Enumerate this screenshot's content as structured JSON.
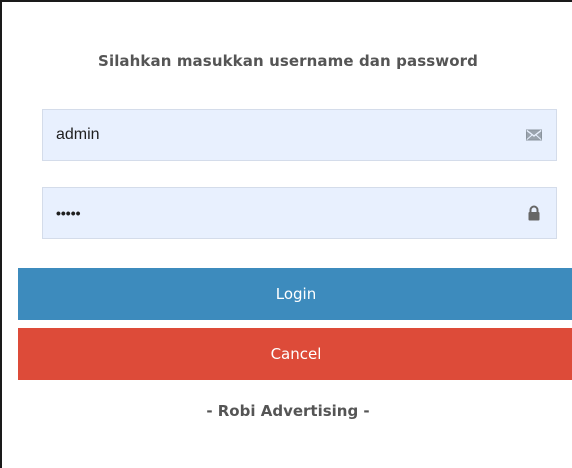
{
  "form": {
    "title": "Silahkan masukkan username dan password",
    "username": {
      "value": "admin",
      "icon": "envelope-icon"
    },
    "password": {
      "value": "•••••",
      "icon": "lock-icon"
    },
    "login_label": "Login",
    "cancel_label": "Cancel",
    "footer": "- Robi Advertising -"
  },
  "colors": {
    "field_background": "#e8f0fe",
    "login_button": "#3d8bbd",
    "cancel_button": "#dd4b39",
    "text": "#555555"
  }
}
